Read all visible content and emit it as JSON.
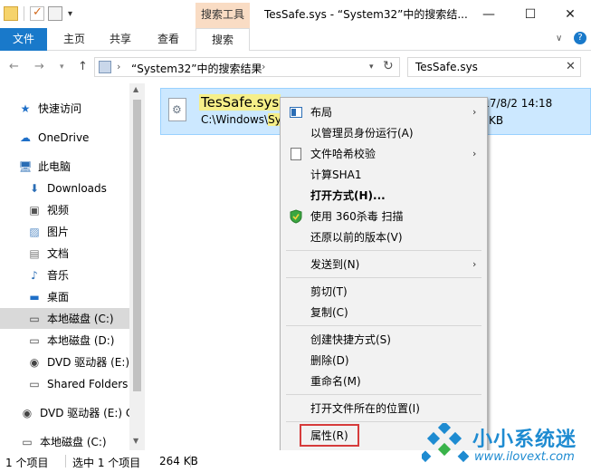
{
  "titlebar": {
    "context_tab": "搜索工具",
    "title": "TesSafe.sys - “System32”中的搜索结...",
    "minimize": "—",
    "maximize": "☐",
    "close": "✕"
  },
  "ribbon": {
    "tabs": [
      "文件",
      "主页",
      "共享",
      "查看",
      "搜索"
    ],
    "expand": "∨",
    "help": "?"
  },
  "nav": {
    "back": "←",
    "forward": "→",
    "recent": "▾",
    "up": "↑",
    "address_sep": "›",
    "address_text": "“System32”中的搜索结果",
    "address_chevron": "›",
    "address_dropdown": "▾",
    "refresh": "↻",
    "search_value": "TesSafe.sys",
    "search_clear": "✕"
  },
  "navpane": {
    "items": [
      {
        "label": "快速访问",
        "icon": "star-icon",
        "glyph": "★",
        "color": "#1e6fc8"
      },
      {
        "label": "OneDrive",
        "icon": "cloud-icon",
        "glyph": "☁",
        "color": "#1e6fc8"
      },
      {
        "label": "此电脑",
        "icon": "computer-icon",
        "glyph": "🖥",
        "color": "#2a6db5"
      },
      {
        "label": "Downloads",
        "icon": "download-icon",
        "glyph": "⬇",
        "color": "#2a6db5"
      },
      {
        "label": "视频",
        "icon": "video-icon",
        "glyph": "▣",
        "color": "#555"
      },
      {
        "label": "图片",
        "icon": "picture-icon",
        "glyph": "▨",
        "color": "#5b8fc7"
      },
      {
        "label": "文档",
        "icon": "document-icon",
        "glyph": "▤",
        "color": "#777"
      },
      {
        "label": "音乐",
        "icon": "music-icon",
        "glyph": "♪",
        "color": "#2a6db5"
      },
      {
        "label": "桌面",
        "icon": "desktop-icon",
        "glyph": "▬",
        "color": "#1e6fc8"
      },
      {
        "label": "本地磁盘 (C:)",
        "icon": "drive-icon",
        "glyph": "▭",
        "color": "#444"
      },
      {
        "label": "本地磁盘 (D:)",
        "icon": "drive-icon",
        "glyph": "▭",
        "color": "#444"
      },
      {
        "label": "DVD 驱动器 (E:)",
        "icon": "dvd-icon",
        "glyph": "◉",
        "color": "#444"
      },
      {
        "label": "Shared Folders",
        "icon": "shared-folder-icon",
        "glyph": "▭",
        "color": "#444"
      },
      {
        "label": "DVD 驱动器 (E:) C",
        "icon": "dvd-icon",
        "glyph": "◉",
        "color": "#444"
      },
      {
        "label": "本地磁盘 (C:)",
        "icon": "drive-icon",
        "glyph": "▭",
        "color": "#444"
      }
    ]
  },
  "file": {
    "name": "TesSafe.sys",
    "path_prefix": "C:\\Windows\\",
    "path_highlight": "Sys",
    "date": "2017/8/2 14:18",
    "size": "KB"
  },
  "context_menu": {
    "items": [
      {
        "label": "布局",
        "icon": "layout-icon",
        "arrow": "›"
      },
      {
        "label": "以管理员身份运行(A)"
      },
      {
        "label": "文件哈希校验",
        "icon": "file-icon",
        "arrow": "›"
      },
      {
        "label": "计算SHA1"
      },
      {
        "label": "打开方式(H)...",
        "bold": true
      },
      {
        "label": "使用 360杀毒 扫描",
        "icon": "shield-icon"
      },
      {
        "label": "还原以前的版本(V)"
      },
      {
        "label": "发送到(N)",
        "arrow": "›"
      },
      {
        "label": "剪切(T)"
      },
      {
        "label": "复制(C)"
      },
      {
        "label": "创建快捷方式(S)"
      },
      {
        "label": "删除(D)"
      },
      {
        "label": "重命名(M)"
      },
      {
        "label": "打开文件所在的位置(I)"
      },
      {
        "label": "属性(R)"
      }
    ]
  },
  "statusbar": {
    "count": "1 个项目",
    "selected": "选中 1 个项目",
    "size": "264 KB"
  },
  "watermark": {
    "brand": "小小系统迷",
    "site": "www.ilovext.com"
  },
  "colors": {
    "accent": "#1979ca",
    "selection": "#cce8ff",
    "search_highlight": "#f6ef89",
    "callout": "#d63b3b",
    "watermark": "#1e8bd1"
  }
}
